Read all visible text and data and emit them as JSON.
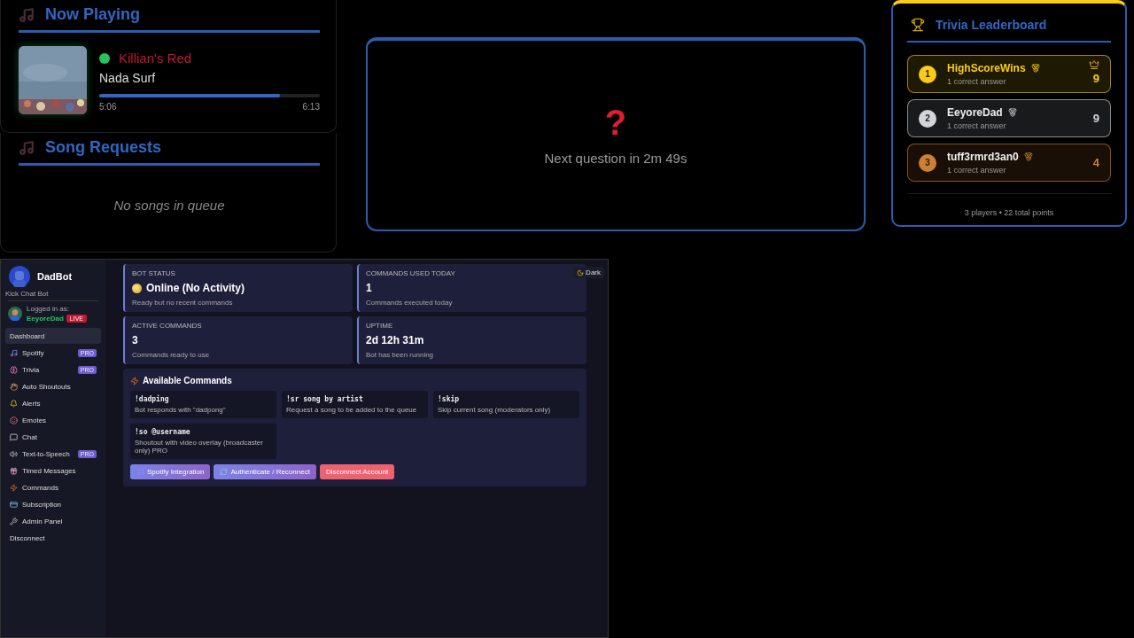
{
  "now_playing": {
    "title": "Now Playing",
    "track": "Killian's Red",
    "artist": "Nada Surf",
    "level": 0.82,
    "elapsed": "5:06",
    "duration": "6:13"
  },
  "song_requests": {
    "title": "Song Requests",
    "empty_text": "No songs in queue"
  },
  "trivia_question": {
    "icon": "?",
    "text": "Next question in 2m 49s"
  },
  "leaderboard": {
    "title": "Trivia Leaderboard",
    "entries": [
      {
        "rank": "1",
        "name": "HighScoreWins",
        "detail": "1 correct answer",
        "score": "9",
        "color": "#facc15",
        "crowned": true
      },
      {
        "rank": "2",
        "name": "EeyoreDad",
        "detail": "1 correct answer",
        "score": "9",
        "color": "#d1d5db",
        "crowned": false
      },
      {
        "rank": "3",
        "name": "tuff3rmrd3an0",
        "detail": "1 correct answer",
        "score": "4",
        "color": "#cd7f32",
        "crowned": false
      }
    ],
    "footer": "3 players • 22 total points"
  },
  "dashboard": {
    "bot_name": "DadBot",
    "bot_subtitle": "Kick Chat Bot",
    "logged_in_label": "Logged in as:",
    "user": "EeyoreDad",
    "live_badge": "LIVE",
    "nav": [
      {
        "label": "Dashboard",
        "selected": true
      },
      {
        "label": "Spotify",
        "badge": "PRO",
        "selected": false
      },
      {
        "label": "Trivia",
        "badge": "PRO",
        "selected": false
      },
      {
        "label": "Auto Shoutouts",
        "selected": false
      },
      {
        "label": "Alerts",
        "selected": false
      },
      {
        "label": "Emotes",
        "selected": false
      },
      {
        "label": "Chat",
        "selected": false
      },
      {
        "label": "Text-to-Speech",
        "badge": "PRO",
        "selected": false
      },
      {
        "label": "Timed Messages",
        "selected": false
      },
      {
        "label": "Commands",
        "selected": false
      },
      {
        "label": "Subscription",
        "selected": false
      },
      {
        "label": "Admin Panel",
        "selected": false
      },
      {
        "label": "Disconnect",
        "selected": false
      }
    ],
    "theme_toggle": "Dark",
    "stats": [
      {
        "label": "BOT STATUS",
        "value": "Online (No Activity)",
        "status_dot": true,
        "note": "Ready but no recent commands"
      },
      {
        "label": "COMMANDS USED TODAY",
        "value": "1",
        "status_dot": false,
        "note": "Commands executed today"
      },
      {
        "label": "ACTIVE COMMANDS",
        "value": "3",
        "status_dot": false,
        "note": "Commands ready to use"
      },
      {
        "label": "UPTIME",
        "value": "2d 12h 31m",
        "status_dot": false,
        "note": "Bot has been running"
      }
    ],
    "commands_title": "Available Commands",
    "commands": [
      {
        "command": "!dadping",
        "description": "Bot responds with \"dadpong\""
      },
      {
        "command": "!sr song by artist",
        "description": "Request a song to be added to the queue"
      },
      {
        "command": "!skip",
        "description": "Skip current song (moderators only)"
      },
      {
        "command": "!so @username",
        "description": "Shoutout with video overlay (broadcaster only) PRO"
      }
    ],
    "actions": [
      {
        "label": "Spotify Integration",
        "kind": "primary"
      },
      {
        "label": "Authenticate / Reconnect",
        "kind": "primary"
      },
      {
        "label": "Disconnect Account",
        "kind": "danger"
      }
    ]
  }
}
